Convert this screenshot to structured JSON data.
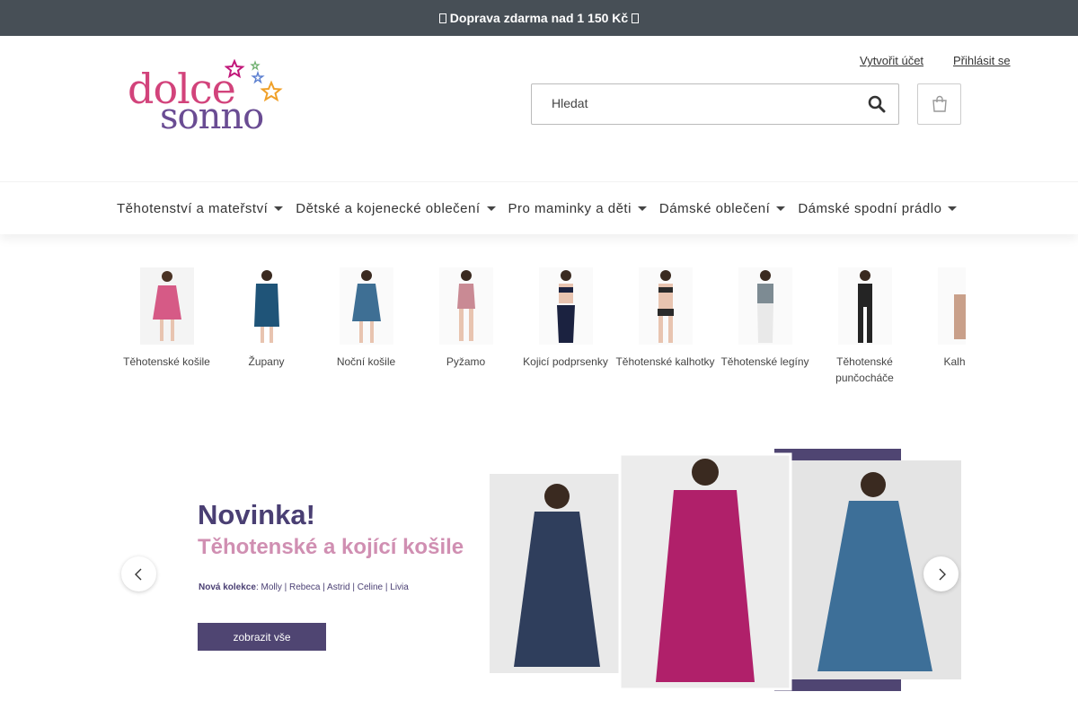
{
  "topbar": {
    "text": "Doprava zdarma nad 1 150 Kč"
  },
  "logo": {
    "line1": "dolce",
    "line2": "sonno"
  },
  "account": {
    "create": "Vytvořit účet",
    "login": "Přihlásit se"
  },
  "search": {
    "placeholder": "Hledat",
    "icon": "search-icon"
  },
  "cart": {
    "icon": "shopping-bag-icon"
  },
  "nav": {
    "items": [
      {
        "label": "Těhotenství a mateřství"
      },
      {
        "label": "Dětské a kojenecké oblečení"
      },
      {
        "label": "Pro maminky a děti"
      },
      {
        "label": "Dámské oblečení"
      },
      {
        "label": "Dámské spodní prádlo"
      }
    ]
  },
  "categories": [
    {
      "label": "Těhotenské košile",
      "color": "#d65a86"
    },
    {
      "label": "Župany",
      "color": "#1f5478"
    },
    {
      "label": "Noční košile",
      "color": "#3e6f94"
    },
    {
      "label": "Pyžamo",
      "color": "#c98a94"
    },
    {
      "label": "Kojicí podprsenky",
      "color": "#1b2240"
    },
    {
      "label": "Těhotenské kalhotky",
      "color": "#2a2a2a"
    },
    {
      "label": "Těhotenské legíny",
      "color": "#7d8b93"
    },
    {
      "label": "Těhotenské punčocháče",
      "color": "#242424"
    },
    {
      "label": "Kalhotky",
      "color": "#c9a08a"
    }
  ],
  "banner": {
    "title": "Novinka!",
    "subtitle": "Těhotenské a kojící košile",
    "collection_label": "Nová kolekce",
    "collection_names": ": Molly | Rebeca | Astrid | Celine | Livia",
    "button": "zobrazit vše",
    "colors": {
      "navy": "#2f3e5c",
      "magenta": "#b0206a",
      "teal": "#3d6f98",
      "frame": "#4f4572"
    }
  },
  "carousel": {
    "prev_icon": "chevron-left-icon",
    "next_icon": "chevron-right-icon"
  }
}
